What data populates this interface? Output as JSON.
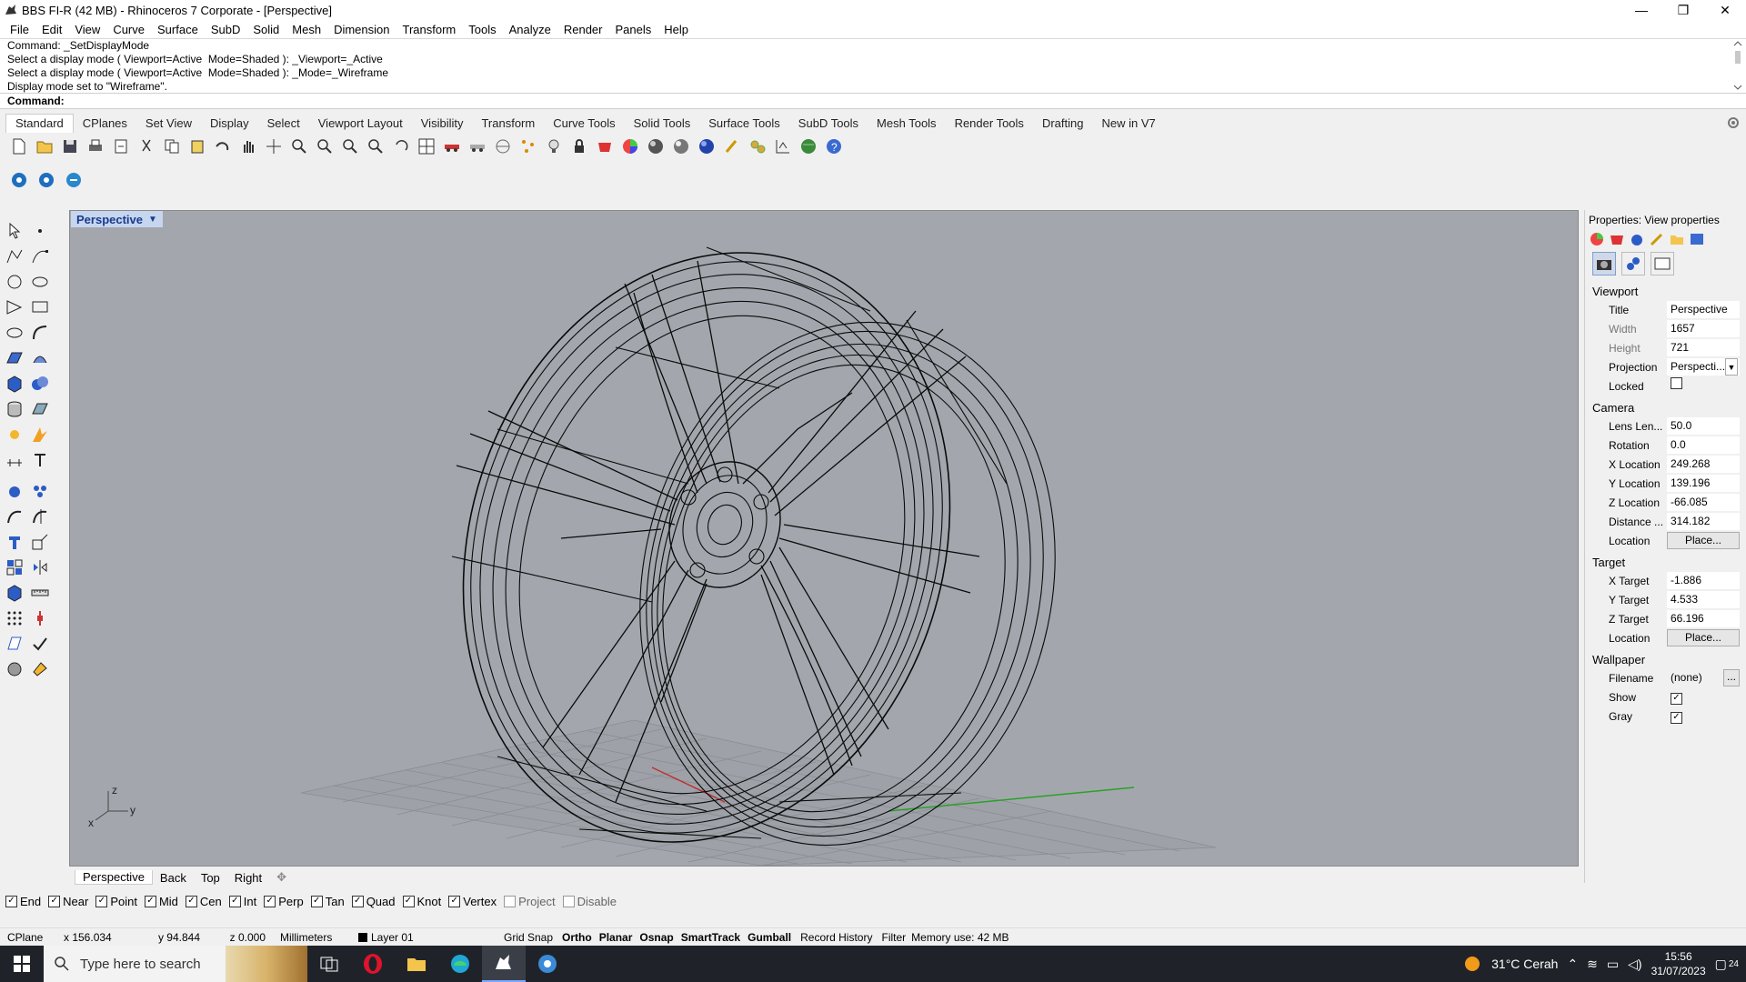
{
  "window": {
    "title": "BBS FI-R (42 MB) - Rhinoceros 7 Corporate - [Perspective]",
    "minimize": "—",
    "maximize": "❐",
    "close": "✕"
  },
  "menu": [
    "File",
    "Edit",
    "View",
    "Curve",
    "Surface",
    "SubD",
    "Solid",
    "Mesh",
    "Dimension",
    "Transform",
    "Tools",
    "Analyze",
    "Render",
    "Panels",
    "Help"
  ],
  "command": {
    "history": [
      "Command: _SetDisplayMode",
      "Select a display mode ( Viewport=Active  Mode=Shaded ): _Viewport=_Active",
      "Select a display mode ( Viewport=Active  Mode=Shaded ): _Mode=_Wireframe",
      "Display mode set to \"Wireframe\"."
    ],
    "prompt": "Command:"
  },
  "toolbar_tabs": [
    "Standard",
    "CPlanes",
    "Set View",
    "Display",
    "Select",
    "Viewport Layout",
    "Visibility",
    "Transform",
    "Curve Tools",
    "Solid Tools",
    "Surface Tools",
    "SubD Tools",
    "Mesh Tools",
    "Render Tools",
    "Drafting",
    "New in V7"
  ],
  "viewport": {
    "title": "Perspective",
    "axis_x": "x",
    "axis_y": "y",
    "axis_z": "z"
  },
  "viewport_tabs": [
    "Perspective",
    "Back",
    "Top",
    "Right"
  ],
  "osnaps": [
    {
      "label": "End",
      "checked": true
    },
    {
      "label": "Near",
      "checked": true
    },
    {
      "label": "Point",
      "checked": true
    },
    {
      "label": "Mid",
      "checked": true
    },
    {
      "label": "Cen",
      "checked": true
    },
    {
      "label": "Int",
      "checked": true
    },
    {
      "label": "Perp",
      "checked": true
    },
    {
      "label": "Tan",
      "checked": true
    },
    {
      "label": "Quad",
      "checked": true
    },
    {
      "label": "Knot",
      "checked": true
    },
    {
      "label": "Vertex",
      "checked": true
    },
    {
      "label": "Project",
      "checked": false
    },
    {
      "label": "Disable",
      "checked": false
    }
  ],
  "status": {
    "cplane": "CPlane",
    "x": "x 156.034",
    "y": "y 94.844",
    "z": "z 0.000",
    "units": "Millimeters",
    "layer": "Layer 01",
    "grid_snap": "Grid Snap",
    "ortho": "Ortho",
    "planar": "Planar",
    "osnap": "Osnap",
    "smarttrack": "SmartTrack",
    "gumball": "Gumball",
    "record_history": "Record History",
    "filter": "Filter",
    "memory": "Memory use: 42 MB"
  },
  "properties": {
    "header": "Properties: View properties",
    "viewport_section": "Viewport",
    "title_label": "Title",
    "title_value": "Perspective",
    "width_label": "Width",
    "width_value": "1657",
    "height_label": "Height",
    "height_value": "721",
    "projection_label": "Projection",
    "projection_value": "Perspecti...",
    "locked_label": "Locked",
    "camera_section": "Camera",
    "lens_label": "Lens Len...",
    "lens_value": "50.0",
    "rotation_label": "Rotation",
    "rotation_value": "0.0",
    "xloc_label": "X Location",
    "xloc_value": "249.268",
    "yloc_label": "Y Location",
    "yloc_value": "139.196",
    "zloc_label": "Z Location",
    "zloc_value": "-66.085",
    "distance_label": "Distance ...",
    "distance_value": "314.182",
    "location_label": "Location",
    "place_button": "Place...",
    "target_section": "Target",
    "xt_label": "X Target",
    "xt_value": "-1.886",
    "yt_label": "Y Target",
    "yt_value": "4.533",
    "zt_label": "Z Target",
    "zt_value": "66.196",
    "tlocation_label": "Location",
    "tplace_button": "Place...",
    "wallpaper_section": "Wallpaper",
    "filename_label": "Filename",
    "filename_value": "(none)",
    "browse_button": "...",
    "show_label": "Show",
    "gray_label": "Gray"
  },
  "taskbar": {
    "search_placeholder": "Type here to search",
    "weather": "31°C  Cerah",
    "time": "15:56",
    "date": "31/07/2023",
    "notifications": "24"
  },
  "colors": {
    "viewport_bg": "#a3a7ad",
    "viewport_title_bg": "#c6d6ef",
    "taskbar_bg": "#1f2329"
  }
}
